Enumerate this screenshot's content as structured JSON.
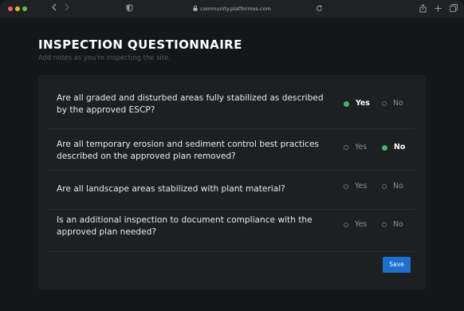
{
  "browser": {
    "url": "community.platformos.com",
    "icons": {
      "back": "chevron-left-icon",
      "forward": "chevron-right-icon",
      "privacy": "shield-icon",
      "lock": "lock-icon",
      "reload": "reload-icon",
      "share": "share-icon",
      "new_tab": "plus-icon",
      "tabs": "tabs-overview-icon"
    }
  },
  "page": {
    "title": "INSPECTION QUESTIONNAIRE",
    "subtitle": "Add notes as you're inspecting the site."
  },
  "questions": [
    {
      "text": "Are all graded and disturbed areas fully stabilized as described by the approved ESCP?",
      "yes_label": "Yes",
      "no_label": "No",
      "selected": "Yes"
    },
    {
      "text": "Are all temporary erosion and sediment control best practices described on the approved plan removed?",
      "yes_label": "Yes",
      "no_label": "No",
      "selected": "No"
    },
    {
      "text": "Are all landscape areas stabilized with plant material?",
      "yes_label": "Yes",
      "no_label": "No",
      "selected": ""
    },
    {
      "text": "Is an additional inspection to document compliance with the approved plan needed?",
      "yes_label": "Yes",
      "no_label": "No",
      "selected": ""
    }
  ],
  "actions": {
    "save_label": "Save"
  },
  "colors": {
    "background": "#151617",
    "card": "#1d1f20",
    "selected_radio": "#3fb871",
    "save_button": "#1f6fcf"
  }
}
